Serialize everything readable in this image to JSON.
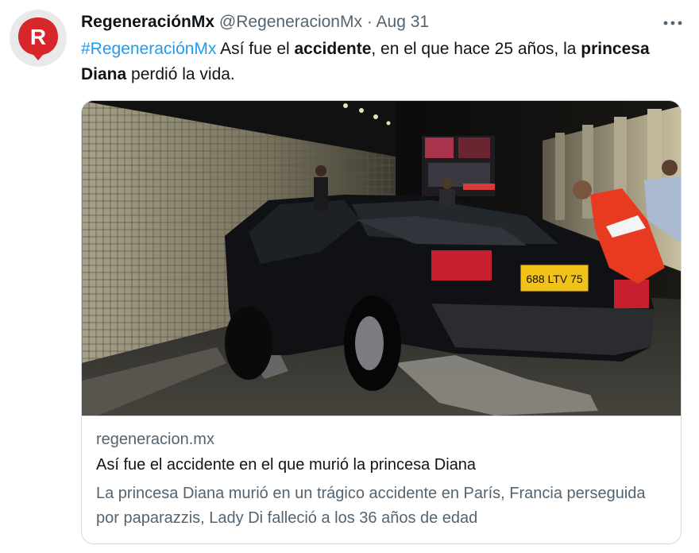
{
  "author": {
    "name": "RegeneraciónMx",
    "handle": "@RegeneracionMx",
    "separator": "·",
    "date": "Aug 31",
    "avatar_letter": "R",
    "avatar_color": "#d7262c"
  },
  "tweet": {
    "hashtag": "#RegeneraciónMx",
    "part1": " Así fue el ",
    "bold1": "accidente",
    "part2": ", en el que hace 25 años, la ",
    "bold2": "princesa Diana",
    "part3": " perdió la vida."
  },
  "card": {
    "domain": "regeneracion.mx",
    "title": "Así fue el accidente en el que murió la princesa Diana",
    "description": "La princesa Diana murió en un trágico accidente en París, Francia perseguida por paparazzis, Lady Di falleció a los 36 años de edad",
    "plate": "688 LTV 75"
  },
  "icons": {
    "more": "more-horizontal-icon"
  },
  "colors": {
    "accent": "#1d9bf0",
    "text": "#0f1419",
    "secondary": "#536471",
    "border": "#cfd9de"
  }
}
